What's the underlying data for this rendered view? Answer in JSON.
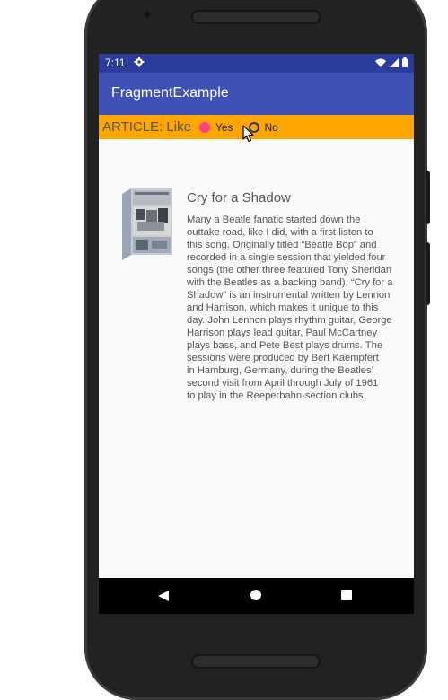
{
  "status_bar": {
    "time": "7:11",
    "icons": [
      "settings-gear-icon",
      "wifi-icon",
      "cellular-signal-icon",
      "battery-icon"
    ]
  },
  "app_bar": {
    "title": "FragmentExample"
  },
  "article_bar": {
    "label": "ARTICLE: Like",
    "options": [
      {
        "label": "Yes",
        "selected": true
      },
      {
        "label": "No",
        "selected": false
      }
    ],
    "background_color": "#ffa500",
    "radio_accent_color": "#ff4081"
  },
  "article": {
    "title": "Cry for a Shadow",
    "image": "beatles-album-box-thumbnail",
    "body_lines": [
      "Many a Beatle fanatic started down the",
      "outtake road, like I did, with a first listen to",
      "this song. Originally titled “Beatle Bop” and",
      "recorded in a single session that yielded four",
      "songs (the other three featured Tony Sheridan",
      "with the Beatles as a backing band), “Cry for a",
      "Shadow” is an instrumental written by Lennon",
      "and Harrison, which makes it unique to this",
      "day. John Lennon plays rhythm guitar, George",
      "Harrison plays lead guitar, Paul McCartney",
      "plays bass, and Pete Best plays drums. The",
      "sessions were produced by Bert Kaempfert",
      "in Hamburg, Germany, during the Beatles’",
      "second visit from April through July of 1961",
      "to play in the Reeperbahn-section clubs."
    ]
  },
  "nav_bar": {
    "buttons": [
      "back-icon",
      "home-icon",
      "recents-icon"
    ]
  },
  "colors": {
    "status_bar": "#2c3c9c",
    "app_bar": "#3f51b5",
    "screen_background": "#fafafa"
  }
}
